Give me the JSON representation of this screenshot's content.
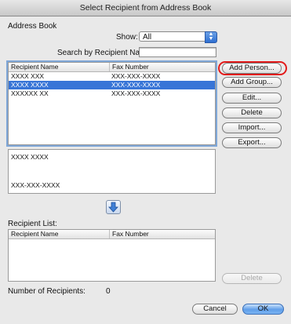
{
  "window": {
    "title": "Select Recipient from Address Book"
  },
  "address_book": {
    "heading": "Address Book",
    "show_label": "Show:",
    "show_value": "All",
    "search_label": "Search by Recipient Name:",
    "search_value": "",
    "columns": [
      "Recipient Name",
      "Fax Number"
    ],
    "rows": [
      {
        "name": "XXXX XXX",
        "fax": "XXX-XXX-XXXX",
        "selected": false
      },
      {
        "name": "XXXX XXXX",
        "fax": "XXX-XXX-XXXX",
        "selected": true
      },
      {
        "name": "XXXXXX XX",
        "fax": "XXX-XXX-XXXX",
        "selected": false
      }
    ]
  },
  "buttons": {
    "add_person": "Add Person...",
    "add_group": "Add Group...",
    "edit": "Edit...",
    "delete": "Delete",
    "import": "Import...",
    "export": "Export..."
  },
  "preview": {
    "name": "XXXX XXXX",
    "fax": "XXX-XXX-XXXX"
  },
  "recipient_list": {
    "heading": "Recipient List:",
    "columns": [
      "Recipient Name",
      "Fax Number"
    ],
    "delete_label": "Delete",
    "count_label": "Number of Recipients:",
    "count_value": "0"
  },
  "footer": {
    "cancel": "Cancel",
    "ok": "OK"
  },
  "colors": {
    "selection": "#3875d7",
    "highlight_ring": "#e21b1b",
    "default_button": "#5f9ee9"
  },
  "icons": {
    "add_arrow": "down-arrow-icon",
    "popup": "popup-arrows-icon"
  }
}
